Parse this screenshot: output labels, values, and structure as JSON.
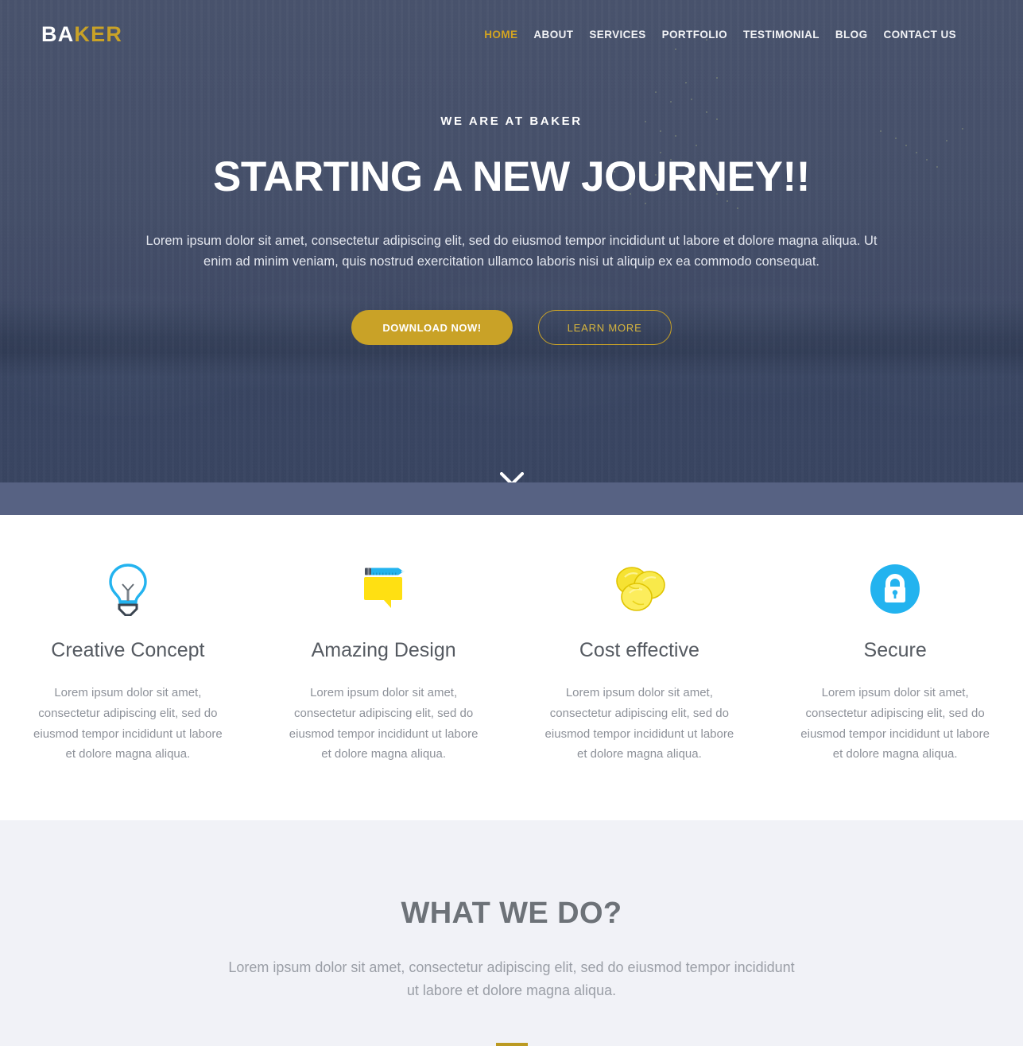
{
  "brand": {
    "name_first": "BA",
    "name_accent": "KER",
    "accent_color": "#c9a227"
  },
  "nav": {
    "items": [
      {
        "label": "HOME",
        "active": true
      },
      {
        "label": "ABOUT",
        "active": false
      },
      {
        "label": "SERVICES",
        "active": false
      },
      {
        "label": "PORTFOLIO",
        "active": false
      },
      {
        "label": "TESTIMONIAL",
        "active": false
      },
      {
        "label": "BLOG",
        "active": false
      },
      {
        "label": "CONTACT US",
        "active": false
      }
    ]
  },
  "hero": {
    "kicker": "WE ARE AT BAKER",
    "title": "STARTING A NEW JOURNEY!!",
    "subtitle": "Lorem ipsum dolor sit amet, consectetur adipiscing elit, sed do eiusmod tempor incididunt ut labore et dolore magna aliqua. Ut enim ad minim veniam, quis nostrud exercitation ullamco laboris nisi ut aliquip ex ea commodo consequat.",
    "primary_button": "DOWNLOAD NOW!",
    "secondary_button": "LEARN MORE",
    "scroll_icon": "chevron-down-icon",
    "overlay_color": "#4b5570"
  },
  "features": {
    "items": [
      {
        "icon": "lightbulb-icon",
        "icon_color": "#23b3ef",
        "title": "Creative Concept",
        "text": "Lorem ipsum dolor sit amet, consectetur adipiscing elit, sed do eiusmod tempor incididunt ut labore et dolore magna aliqua."
      },
      {
        "icon": "design-pencil-speech-bubble-icon",
        "icon_color": "#ffe012",
        "title": "Amazing Design",
        "text": "Lorem ipsum dolor sit amet, consectetur adipiscing elit, sed do eiusmod tempor incididunt ut labore et dolore magna aliqua."
      },
      {
        "icon": "coins-icon",
        "icon_color": "#f6e233",
        "title": "Cost effective",
        "text": "Lorem ipsum dolor sit amet, consectetur adipiscing elit, sed do eiusmod tempor incididunt ut labore et dolore magna aliqua."
      },
      {
        "icon": "lock-circle-icon",
        "icon_color": "#23b3ef",
        "title": "Secure",
        "text": "Lorem ipsum dolor sit amet, consectetur adipiscing elit, sed do eiusmod tempor incididunt ut labore et dolore magna aliqua."
      }
    ]
  },
  "what_we_do": {
    "title": "WHAT WE DO?",
    "subtitle": "Lorem ipsum dolor sit amet, consectetur adipiscing elit, sed do eiusmod tempor incididunt ut labore et dolore magna aliqua.",
    "divider_color": "#bb9a22",
    "background_color": "#f1f2f7"
  }
}
